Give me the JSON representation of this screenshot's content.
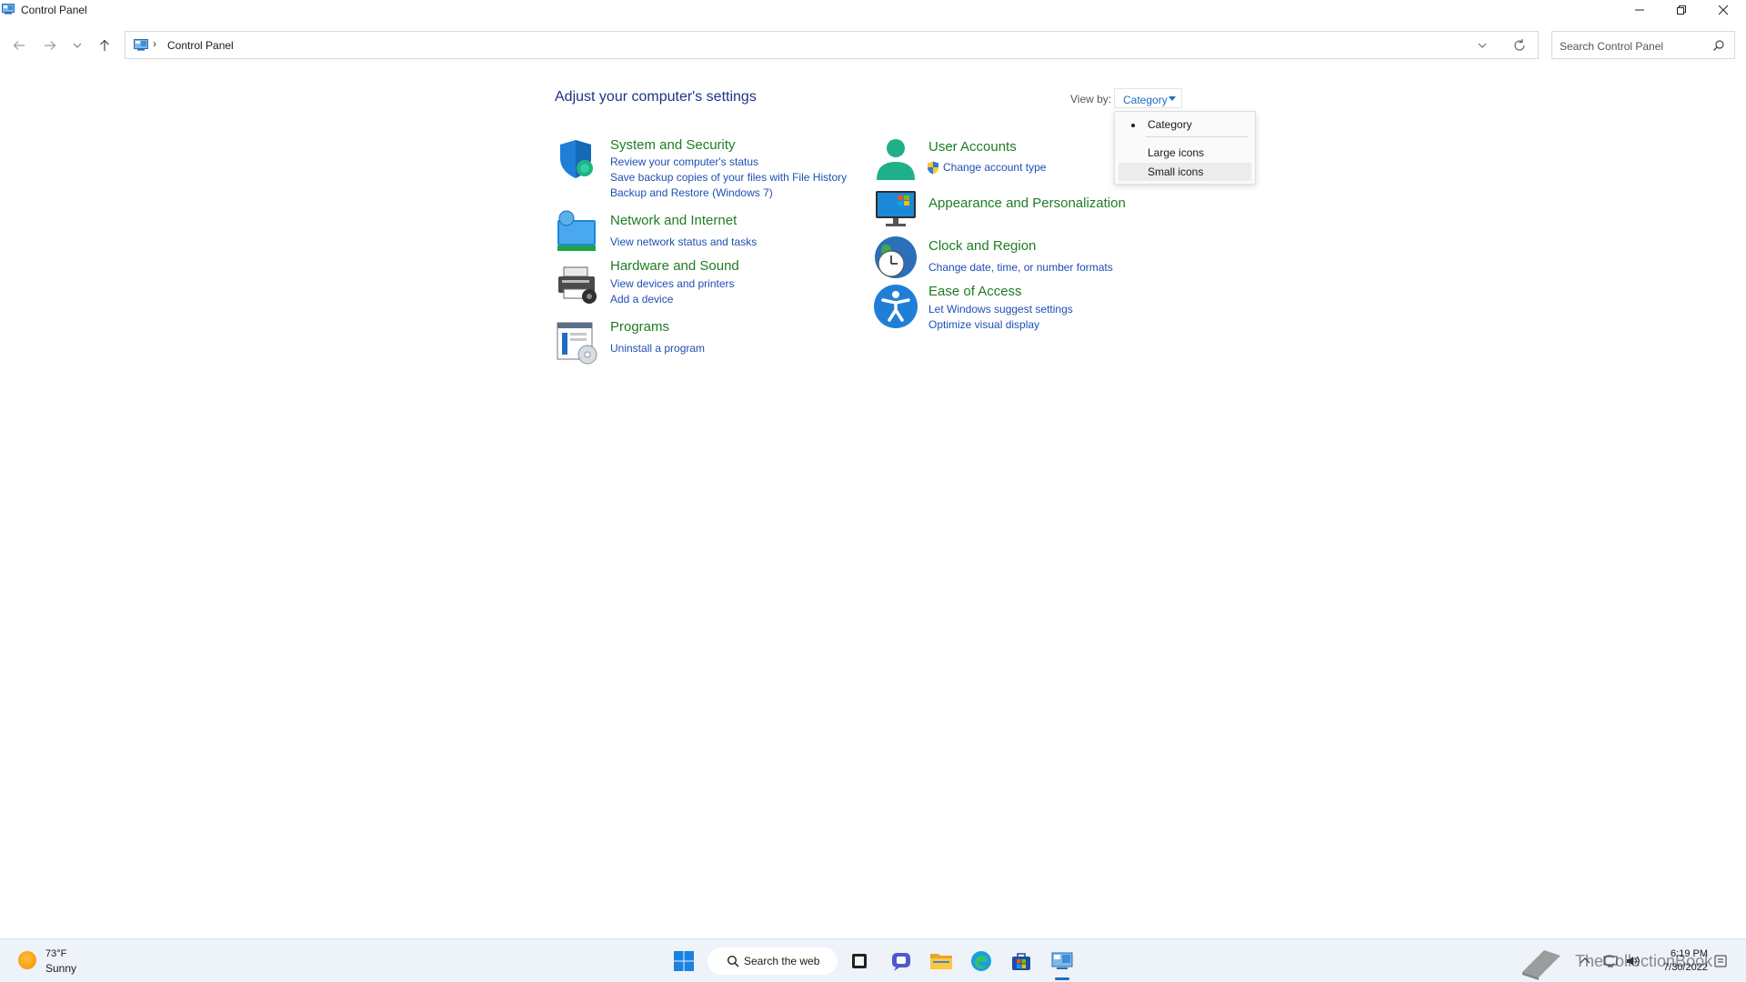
{
  "window": {
    "title": "Control Panel"
  },
  "address": {
    "breadcrumb": "Control Panel",
    "separator": "›"
  },
  "search": {
    "placeholder": "Search Control Panel"
  },
  "main": {
    "heading": "Adjust your computer's settings",
    "view_by_label": "View by:",
    "view_by_value": "Category",
    "view_menu": {
      "items": [
        "Category",
        "Large icons",
        "Small icons"
      ],
      "selected": "Category",
      "hovered": "Small icons"
    },
    "categories": [
      {
        "title": "System and Security",
        "icon": "shield-icon",
        "links": [
          "Review your computer's status",
          "Save backup copies of your files with File History",
          "Backup and Restore (Windows 7)"
        ]
      },
      {
        "title": "Network and Internet",
        "icon": "network-icon",
        "links": [
          "View network status and tasks"
        ]
      },
      {
        "title": "Hardware and Sound",
        "icon": "printer-icon",
        "links": [
          "View devices and printers",
          "Add a device"
        ]
      },
      {
        "title": "Programs",
        "icon": "programs-icon",
        "links": [
          "Uninstall a program"
        ]
      },
      {
        "title": "User Accounts",
        "icon": "user-icon",
        "links": [
          "Change account type"
        ]
      },
      {
        "title": "Appearance and Personalization",
        "icon": "monitor-icon",
        "links": []
      },
      {
        "title": "Clock and Region",
        "icon": "clock-globe-icon",
        "links": [
          "Change date, time, or number formats"
        ]
      },
      {
        "title": "Ease of Access",
        "icon": "accessibility-icon",
        "links": [
          "Let Windows suggest settings",
          "Optimize visual display"
        ]
      }
    ]
  },
  "taskbar": {
    "weather_temp": "73°F",
    "weather_condition": "Sunny",
    "search_label": "Search the web",
    "time": "6:19 PM",
    "date": "7/30/2022",
    "watermark": "TheCollectionBook"
  },
  "colors": {
    "link": "#1e4fb4",
    "category_title": "#1e7d22",
    "heading": "#1e3287",
    "accent": "#1a6fc4"
  }
}
